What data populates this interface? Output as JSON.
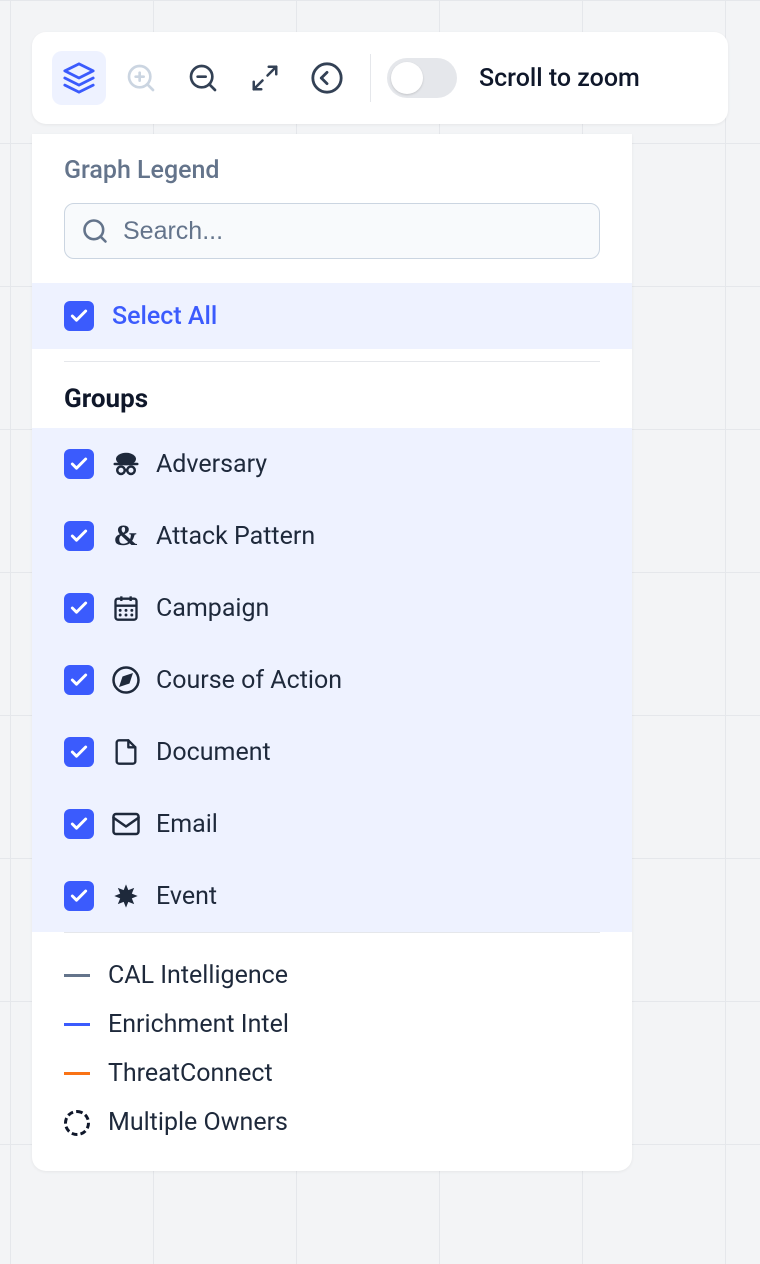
{
  "toolbar": {
    "scroll_to_zoom_label": "Scroll to zoom"
  },
  "legend": {
    "title": "Graph Legend",
    "search_placeholder": "Search...",
    "select_all_label": "Select All",
    "groups_header": "Groups",
    "groups": [
      {
        "label": "Adversary",
        "icon": "adversary"
      },
      {
        "label": "Attack Pattern",
        "icon": "attack-pattern"
      },
      {
        "label": "Campaign",
        "icon": "campaign"
      },
      {
        "label": "Course of Action",
        "icon": "course-of-action"
      },
      {
        "label": "Document",
        "icon": "document"
      },
      {
        "label": "Email",
        "icon": "email"
      },
      {
        "label": "Event",
        "icon": "event"
      }
    ],
    "lines": [
      {
        "label": "CAL Intelligence",
        "color": "#64748b"
      },
      {
        "label": "Enrichment Intel",
        "color": "#3b5bfd"
      },
      {
        "label": "ThreatConnect",
        "color": "#f97316"
      }
    ],
    "multiple_owners_label": "Multiple Owners"
  }
}
